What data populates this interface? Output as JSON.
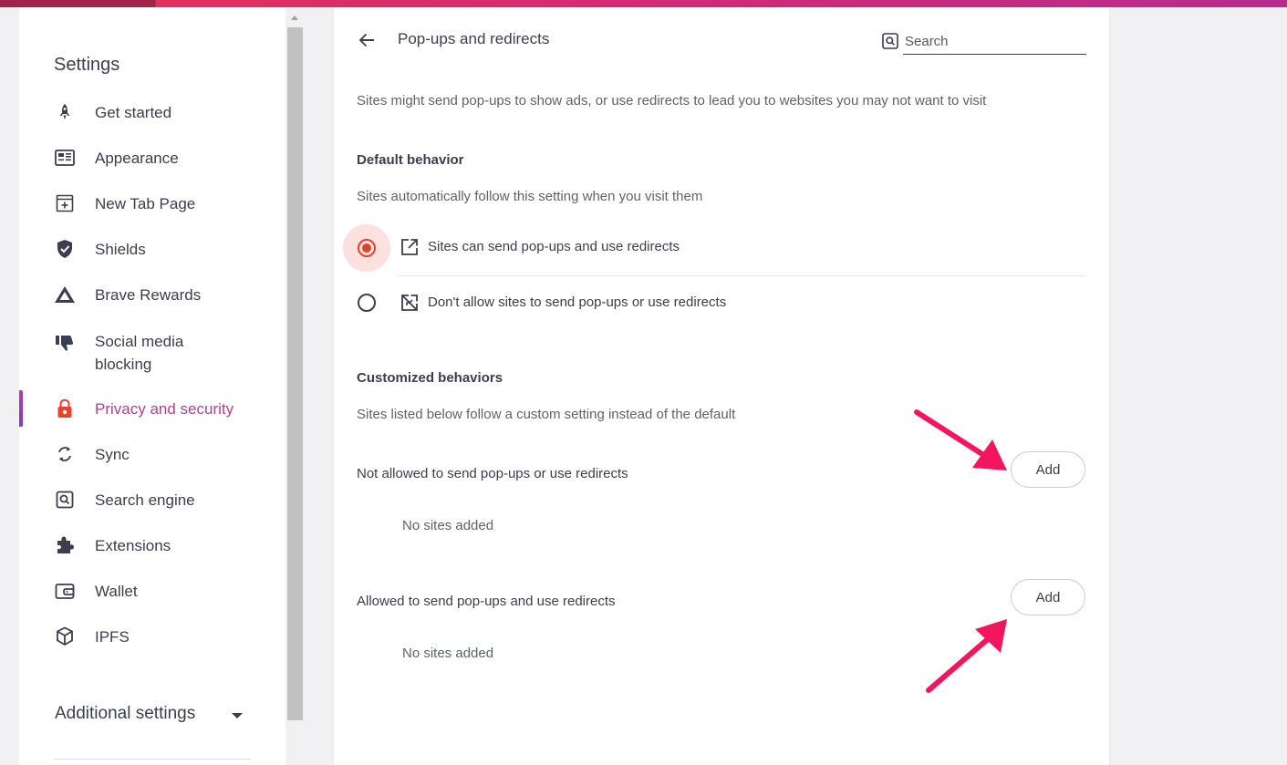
{
  "colors": {
    "accent": "#b4408e",
    "radio_checked": "#e2422a",
    "annotation_arrow": "#f4155f"
  },
  "sidebar": {
    "title": "Settings",
    "items": [
      {
        "label": "Get started",
        "icon": "rocket-icon"
      },
      {
        "label": "Appearance",
        "icon": "appearance-icon"
      },
      {
        "label": "New Tab Page",
        "icon": "new-tab-icon"
      },
      {
        "label": "Shields",
        "icon": "shield-icon"
      },
      {
        "label": "Brave Rewards",
        "icon": "triangle-icon"
      },
      {
        "label": "Social media\nblocking",
        "icon": "thumbs-down-icon"
      },
      {
        "label": "Privacy and security",
        "icon": "lock-icon",
        "active": true
      },
      {
        "label": "Sync",
        "icon": "sync-icon"
      },
      {
        "label": "Search engine",
        "icon": "search-icon"
      },
      {
        "label": "Extensions",
        "icon": "puzzle-icon"
      },
      {
        "label": "Wallet",
        "icon": "wallet-icon"
      },
      {
        "label": "IPFS",
        "icon": "cube-icon"
      }
    ],
    "additional": "Additional settings"
  },
  "panel": {
    "title": "Pop-ups and redirects",
    "search": {
      "placeholder": "Search"
    },
    "description": "Sites might send pop-ups to show ads, or use redirects to lead you to websites you may not want to visit",
    "default": {
      "heading": "Default behavior",
      "subtitle": "Sites automatically follow this setting when you visit them",
      "options": [
        {
          "label": "Sites can send pop-ups and use redirects",
          "checked": true,
          "icon": "open-in-new-icon"
        },
        {
          "label": "Don't allow sites to send pop-ups or use redirects",
          "checked": false,
          "icon": "blocked-popup-icon"
        }
      ]
    },
    "custom": {
      "heading": "Customized behaviors",
      "subtitle": "Sites listed below follow a custom setting instead of the default",
      "blocked": {
        "label": "Not allowed to send pop-ups or use redirects",
        "button": "Add",
        "empty": "No sites added"
      },
      "allowed": {
        "label": "Allowed to send pop-ups and use redirects",
        "button": "Add",
        "empty": "No sites added"
      }
    }
  }
}
